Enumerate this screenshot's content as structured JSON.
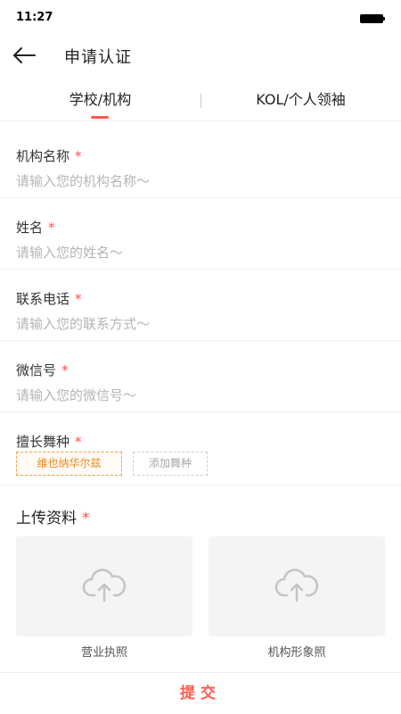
{
  "status_bar": {
    "time": "11:27"
  },
  "nav": {
    "title": "申请认证",
    "back_icon": "back-arrow-icon"
  },
  "tabs": [
    {
      "label": "学校/机构",
      "active": true
    },
    {
      "label": "KOL/个人领袖",
      "active": false
    }
  ],
  "form": {
    "fields": [
      {
        "label": "机构名称",
        "required_mark": "*",
        "placeholder": "请输入您的机构名称～",
        "value": ""
      },
      {
        "label": "姓名",
        "required_mark": "*",
        "placeholder": "请输入您的姓名～",
        "value": ""
      },
      {
        "label": "联系电话",
        "required_mark": "*",
        "placeholder": "请输入您的联系方式～",
        "value": ""
      },
      {
        "label": "微信号",
        "required_mark": "*",
        "placeholder": "请输入您的微信号～",
        "value": ""
      }
    ],
    "dance": {
      "label": "擅长舞种",
      "required_mark": "*",
      "selected": [
        "维也纳华尔兹"
      ],
      "add_label": "添加舞种"
    }
  },
  "upload": {
    "title": "上传资料",
    "required_mark": "*",
    "cards": [
      {
        "caption": "营业执照",
        "icon": "cloud-upload-icon"
      },
      {
        "caption": "机构形象照",
        "icon": "cloud-upload-icon"
      }
    ]
  },
  "submit_label": "提交",
  "colors": {
    "accent": "#ff5a4e",
    "required": "#ff4d4f",
    "chip_selected": "#ee8a1f",
    "placeholder": "#b5b5b5"
  }
}
